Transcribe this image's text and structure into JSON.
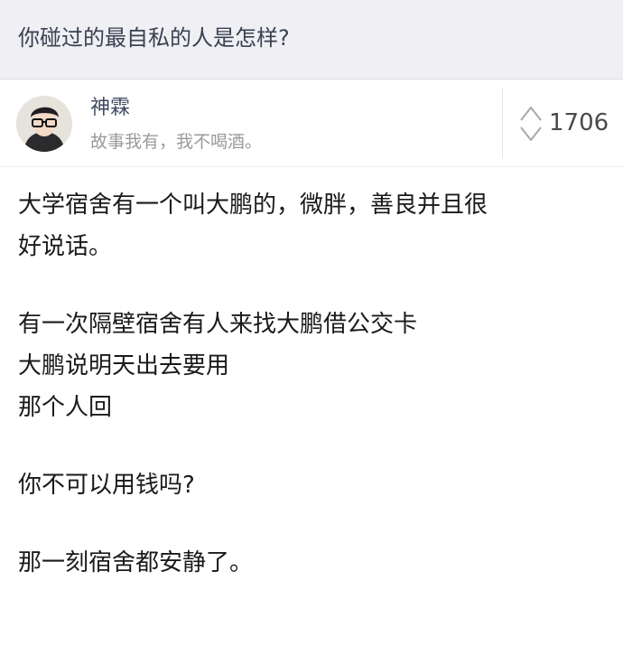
{
  "question": {
    "title": "你碰过的最自私的人是怎样?"
  },
  "author": {
    "avatar_icon": "user-avatar",
    "name": "神霖",
    "bio": "故事我有，我不喝酒。"
  },
  "vote": {
    "icon": "up-down-vote-arrows",
    "count": "1706"
  },
  "answer": {
    "paragraphs": [
      "大学宿舍有一个叫大鹏的，微胖，善良并且很\n好说话。",
      "有一次隔壁宿舍有人来找大鹏借公交卡\n大鹏说明天出去要用\n那个人回",
      "你不可以用钱吗?",
      "那一刻宿舍都安静了。"
    ]
  },
  "colors": {
    "question_bg": "#efeff4",
    "title_text": "#3a4150",
    "name_text": "#3f4a63",
    "bio_text": "#9a9a9f",
    "body_text": "#1a1a1a"
  }
}
